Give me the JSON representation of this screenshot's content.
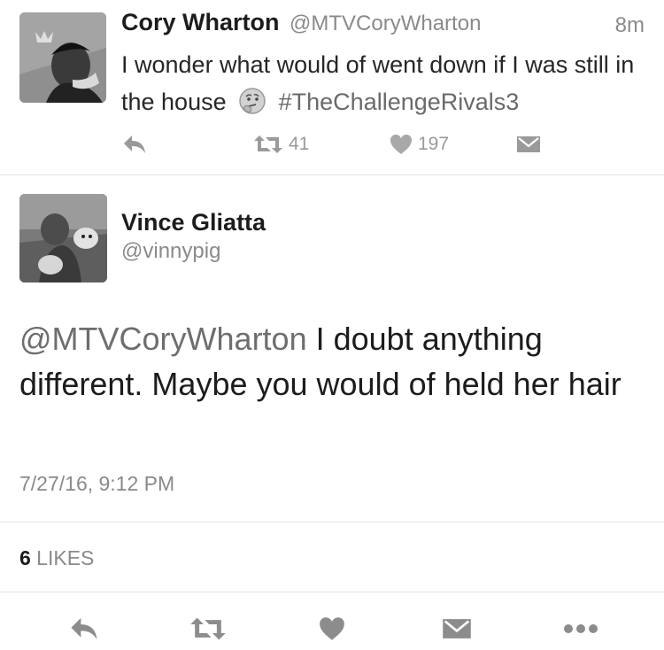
{
  "tweet1": {
    "author_name": "Cory Wharton",
    "author_handle": "@MTVCoryWharton",
    "time_ago": "8m",
    "text_part1": "I wonder what would of went down if I was still in the house",
    "hashtag": "#TheChallengeRivals3",
    "emoji_icon": "thinking-face-icon",
    "retweet_count": "41",
    "like_count": "197"
  },
  "tweet2": {
    "author_name": "Vince Gliatta",
    "author_handle": "@vinnypig",
    "mention": "@MTVCoryWharton",
    "text": " I doubt anything different. Maybe you would of held her hair",
    "timestamp": "7/27/16, 9:12 PM",
    "likes_count": "6",
    "likes_label": " LIKES"
  },
  "icons": [
    "reply-icon",
    "retweet-icon",
    "heart-icon",
    "direct-message-icon",
    "more-icon"
  ],
  "colors": {
    "text": "#1c1c1c",
    "muted": "#8a8a8a",
    "divider": "#e4e4e4"
  }
}
